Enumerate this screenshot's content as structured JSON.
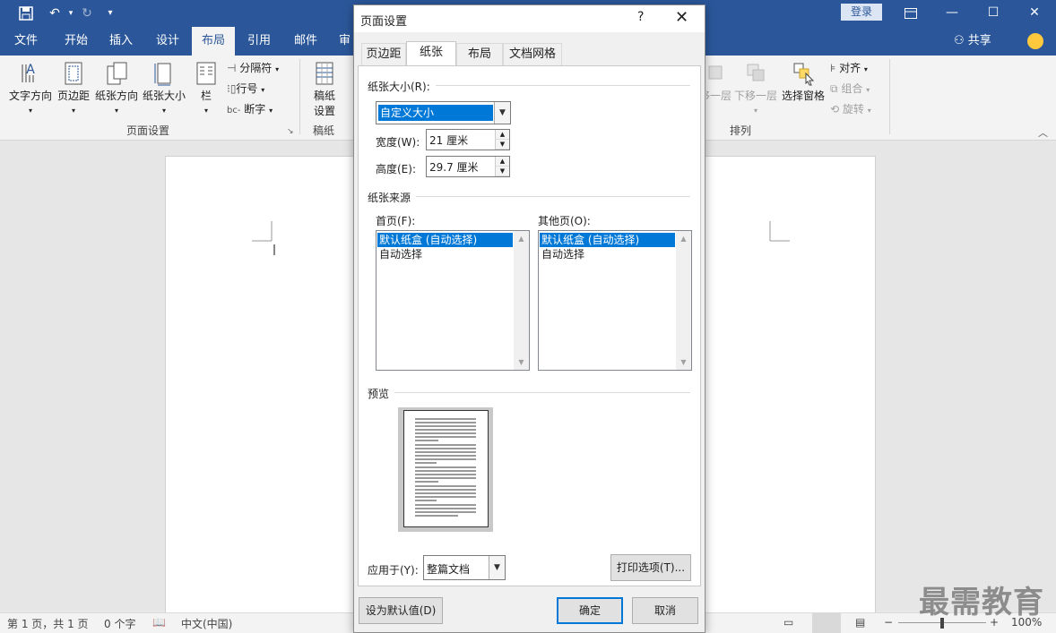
{
  "titlebar": {
    "login": "登录"
  },
  "ribbon_tabs": [
    "文件",
    "开始",
    "插入",
    "设计",
    "布局",
    "引用",
    "邮件",
    "审阅"
  ],
  "share_label": "共享",
  "ribbon": {
    "page_setup": {
      "text_direction": "文字方向",
      "margins": "页边距",
      "orientation": "纸张方向",
      "size": "纸张大小",
      "columns": "栏",
      "breaks": "分隔符",
      "line_numbers": "行号",
      "hyphenation": "断字",
      "group_label": "页面设置"
    },
    "manuscript": {
      "button": "稿纸\n设置",
      "button_line1": "稿纸",
      "button_line2": "设置",
      "group_label": "稿纸"
    },
    "arrange": {
      "bring_forward": "上移一层",
      "send_backward": "下移一层",
      "selection_pane": "选择窗格",
      "align": "对齐",
      "group": "组合",
      "rotate": "旋转",
      "group_label": "排列"
    }
  },
  "dialog": {
    "title": "页面设置",
    "help": "?",
    "tabs": [
      "页边距",
      "纸张",
      "布局",
      "文档网格"
    ],
    "active_tab": "纸张",
    "paper_size_section": "纸张大小(R):",
    "paper_size_value": "自定义大小",
    "width_label": "宽度(W):",
    "width_value": "21 厘米",
    "height_label": "高度(E):",
    "height_value": "29.7 厘米",
    "paper_source_section": "纸张来源",
    "first_page_label": "首页(F):",
    "other_pages_label": "其他页(O):",
    "first_page_items": [
      "默认纸盒 (自动选择)",
      "自动选择"
    ],
    "other_pages_items": [
      "默认纸盒 (自动选择)",
      "自动选择"
    ],
    "preview_section": "预览",
    "apply_to_label": "应用于(Y):",
    "apply_to_value": "整篇文档",
    "print_options": "打印选项(T)...",
    "set_default": "设为默认值(D)",
    "ok": "确定",
    "cancel": "取消"
  },
  "statusbar": {
    "page": "第 1 页，共 1 页",
    "words": "0 个字",
    "language": "中文(中国)",
    "zoom": "100%"
  },
  "watermark": "最需教育",
  "colors": {
    "accent": "#2b579a",
    "selection": "#0078d7"
  }
}
